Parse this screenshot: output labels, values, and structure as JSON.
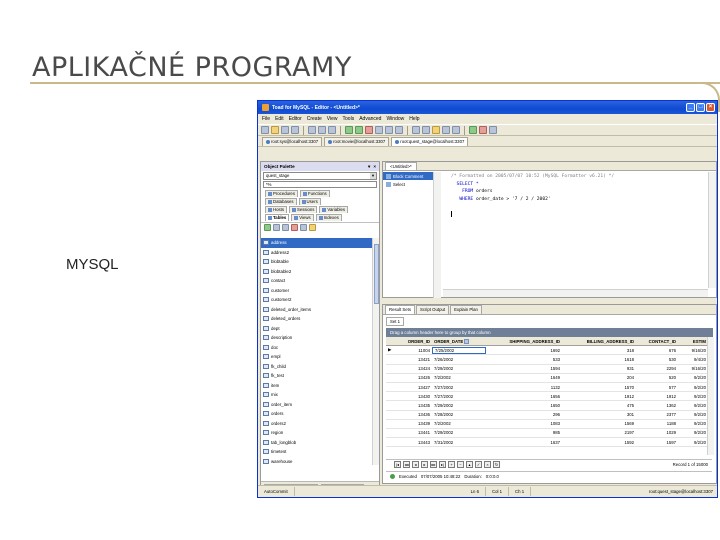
{
  "slide": {
    "title": "APLIKAČNÉ PROGRAMY",
    "bullet": "MYSQL"
  },
  "app": {
    "window_title": "Toad for MySQL - Editor - <Untitled>*",
    "menu": [
      "File",
      "Edit",
      "Editor",
      "Create",
      "View",
      "Tools",
      "Advanced",
      "Window",
      "Help"
    ],
    "connections": [
      "root:sys@localhost:3307",
      "root:movie@localhost:3307",
      "root:quest_stage@localhost:3307"
    ]
  },
  "palette": {
    "title": "Object Palette",
    "schema": "quest_stage",
    "filter": "*%",
    "object_types_row1": [
      "Procedures",
      "Functions"
    ],
    "object_types_row2": [
      "Databases",
      "Users"
    ],
    "object_types_row3": [
      "Hosts",
      "Sessions",
      "Variables"
    ],
    "object_types_row4": [
      "Tables",
      "Views",
      "Indexes"
    ],
    "tables": [
      "address",
      "address2",
      "blobtable",
      "blobtable2",
      "contact",
      "customer",
      "customer2",
      "deleted_order_items",
      "deleted_orders",
      "dept",
      "description",
      "doc",
      "empl",
      "fk_child",
      "fk_test",
      "item",
      "mix",
      "order_item",
      "orders",
      "orders2",
      "region",
      "tab_longblob",
      "timetest",
      "warehouse"
    ],
    "bottom_tabs": [
      "Connection Manager",
      "Object Palette"
    ]
  },
  "editor": {
    "tab": "<Untitled>*",
    "tree": [
      "Block Comment",
      "Select"
    ],
    "code_comment": "/* Formatted on 2005/07/07 10:52 (MySQL Formatter v6.21) */",
    "code_select": "SELECT *",
    "code_from_kw": "FROM",
    "code_from_val": "orders",
    "code_where_kw": "WHERE",
    "code_where_val": "order_date > '7 / 2 / 2002'"
  },
  "results": {
    "tabs": [
      "Result Sets",
      "Script Output",
      "Explain Plan"
    ],
    "set_tab": "Set 1",
    "group_hint": "Drag a column header here to group by that column",
    "columns": [
      "ORDER_ID",
      "ORDER_DATE",
      "SHIPPING_ADDRESS_ID",
      "BILLING_ADDRESS_ID",
      "CONTACT_ID",
      "ESTIM"
    ],
    "rows": [
      [
        "11004",
        "7/25/2002",
        "1692",
        "318",
        "676",
        "9/16/20"
      ],
      [
        "13421",
        "7/26/2002",
        "533",
        "1618",
        "530",
        "9/4/20"
      ],
      [
        "13424",
        "7/29/2002",
        "1594",
        "931",
        "2294",
        "9/16/20"
      ],
      [
        "13426",
        "7/2/2002",
        "1649",
        "204",
        "520",
        "9/2/20"
      ],
      [
        "13427",
        "7/27/2002",
        "1132",
        "1570",
        "577",
        "9/2/20"
      ],
      [
        "13430",
        "7/27/2002",
        "1656",
        "1912",
        "1912",
        "9/2/20"
      ],
      [
        "13435",
        "7/29/2002",
        "1650",
        "475",
        "1362",
        "9/2/20"
      ],
      [
        "13436",
        "7/28/2002",
        "296",
        "301",
        "2377",
        "9/2/20"
      ],
      [
        "13439",
        "7/2/2002",
        "1083",
        "1569",
        "1188",
        "9/2/20"
      ],
      [
        "13441",
        "7/29/2002",
        "985",
        "2197",
        "1029",
        "9/2/20"
      ],
      [
        "13443",
        "7/31/2002",
        "1637",
        "1592",
        "1597",
        "9/2/20"
      ]
    ],
    "record_info": "Record 1 of 15000",
    "executed_label": "Executed",
    "executed_time": "07/07/2005 10:48:22",
    "duration_label": "Duration:",
    "duration": "0:0:0.0"
  },
  "status": {
    "autocommit": "AutoCommit",
    "ln": "Ln 6",
    "col": "Col 1",
    "ch": "Ch 1",
    "connection": "root:quest_stage@localhost:3307"
  }
}
